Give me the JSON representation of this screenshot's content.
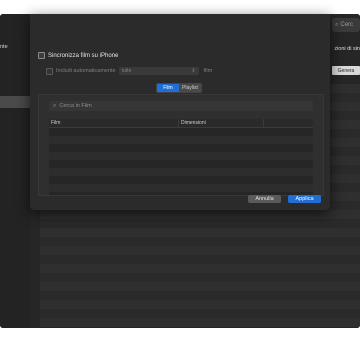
{
  "app": {
    "sidebar_fragment": "nte",
    "search_placeholder": "Cerc",
    "right_header": "zioni di sin",
    "right_button": "Genera"
  },
  "sheet": {
    "sync_label": "Sincronizza film su iPhone",
    "auto_include_label": "Includi automaticamente",
    "auto_include_value": "tutte",
    "auto_include_unit": "film",
    "tabs": [
      {
        "label": "Film",
        "selected": true
      },
      {
        "label": "Playlist",
        "selected": false
      }
    ],
    "search_placeholder": "Cerca in Film",
    "columns": [
      "Film",
      "Dimensioni",
      ""
    ],
    "cancel_label": "Annulla",
    "apply_label": "Applica"
  },
  "colors": {
    "accent": "#1f6fd6",
    "background": "#2b2b2b"
  }
}
